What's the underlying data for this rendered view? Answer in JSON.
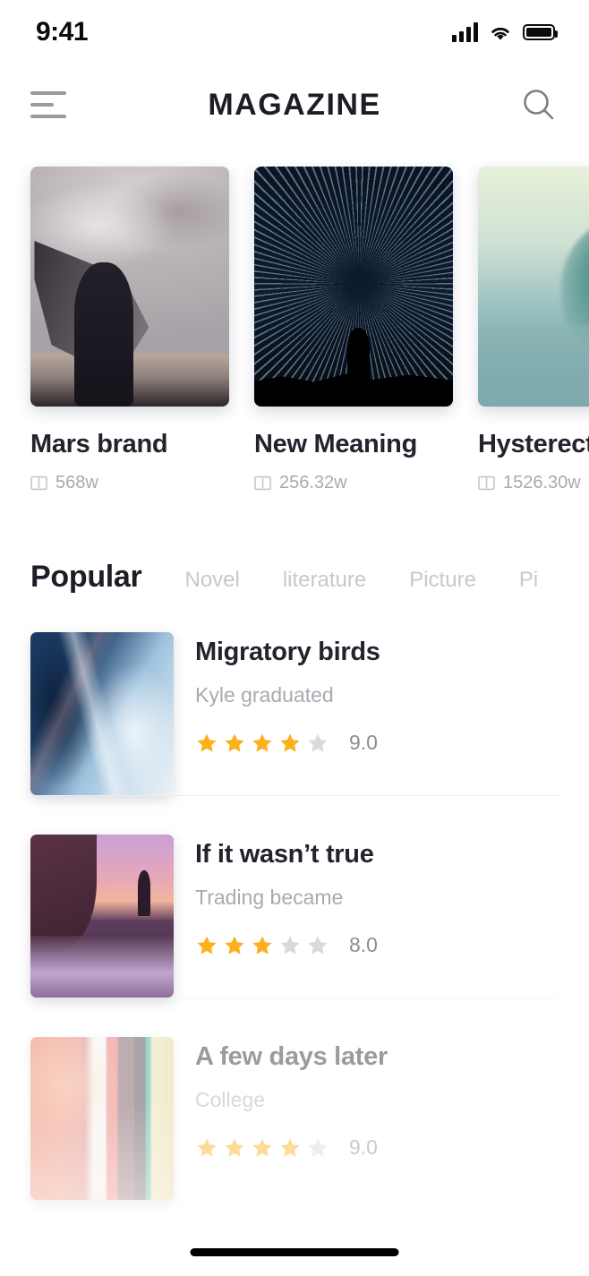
{
  "status_bar": {
    "time": "9:41",
    "signal_icon": "cellular-signal-icon",
    "wifi_icon": "wifi-icon",
    "battery_icon": "battery-full-icon"
  },
  "nav": {
    "menu_icon": "hamburger-menu-icon",
    "title": "MAGAZINE",
    "search_icon": "search-icon"
  },
  "featured": [
    {
      "title": "Mars brand",
      "meta": "568w",
      "meta_icon": "open-book-icon"
    },
    {
      "title": "New Meaning",
      "meta": "256.32w",
      "meta_icon": "open-book-icon"
    },
    {
      "title": "Hysterecto",
      "meta": "1526.30w",
      "meta_icon": "open-book-icon"
    }
  ],
  "tabs": [
    {
      "label": "Popular",
      "active": true
    },
    {
      "label": "Novel",
      "active": false
    },
    {
      "label": "literature",
      "active": false
    },
    {
      "label": "Picture",
      "active": false
    },
    {
      "label": "Pi",
      "active": false
    }
  ],
  "list": [
    {
      "title": "Migratory birds",
      "subtitle": "Kyle graduated",
      "stars_filled": 4,
      "stars_total": 5,
      "score": "9.0"
    },
    {
      "title": "If it wasn’t true",
      "subtitle": "Trading became",
      "stars_filled": 3,
      "stars_total": 5,
      "score": "8.0"
    },
    {
      "title": "A few days later",
      "subtitle": "College",
      "stars_filled": 4,
      "stars_total": 5,
      "score": "9.0"
    }
  ],
  "colors": {
    "text_primary": "#22232c",
    "text_muted": "#a9aab1",
    "star_filled": "#fcb01e",
    "star_empty": "#d8dade",
    "divider": "#eceef2"
  },
  "home_indicator": "home-indicator"
}
